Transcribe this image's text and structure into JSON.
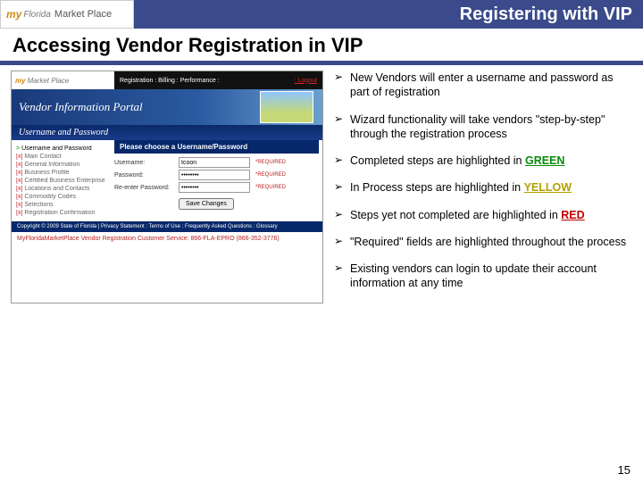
{
  "header": {
    "title": "Registering with VIP"
  },
  "subtitle": "Accessing Vendor Registration in VIP",
  "logo": {
    "my": "my",
    "florida": "Florida",
    "marketplace": "Market Place"
  },
  "screenshot": {
    "nav": {
      "items": "Registration : Billing : Performance :",
      "logout": ": Logout"
    },
    "banner": "Vendor Information Portal",
    "subbanner": "Username and Password",
    "sidebar": [
      {
        "marker": ">",
        "label": "Username and Password",
        "current": true
      },
      {
        "marker": "[x]",
        "label": "Main Contact"
      },
      {
        "marker": "[x]",
        "label": "General Information"
      },
      {
        "marker": "[x]",
        "label": "Business Profile"
      },
      {
        "marker": "[x]",
        "label": "Certified Business Enterprise"
      },
      {
        "marker": "[x]",
        "label": "Locations and Contacts"
      },
      {
        "marker": "[x]",
        "label": "Commodity Codes"
      },
      {
        "marker": "[x]",
        "label": "Selections"
      },
      {
        "marker": "[x]",
        "label": "Registration Confirmation"
      }
    ],
    "formHeader": "Please choose a Username/Password",
    "fields": {
      "username": {
        "label": "Username:",
        "value": "tcoon",
        "required": "*REQUIRED"
      },
      "password": {
        "label": "Password:",
        "value": "••••••••",
        "required": "*REQUIRED"
      },
      "password2": {
        "label": "Re-enter Password:",
        "value": "••••••••",
        "required": "*REQUIRED"
      }
    },
    "button": "Save Changes",
    "footer": "Copyright © 2009 State of Florida | Privacy Statement : Terms of Use : Frequently Asked Questions : Glossary",
    "support": "MyFloridaMarketPlace Vendor Registration Customer Service: 866-FLA-EPRO (866-352-3776)"
  },
  "bullets": [
    {
      "text": "New Vendors will enter a username and password as part of registration"
    },
    {
      "text": "Wizard functionality will take vendors \"step-by-step\" through the registration process"
    },
    {
      "text": "Completed steps are highlighted in ",
      "suffixClass": "green",
      "suffix": "GREEN"
    },
    {
      "text": "In Process steps are highlighted in ",
      "suffixClass": "yellow",
      "suffix": "YELLOW"
    },
    {
      "text": "Steps yet not completed are highlighted in ",
      "suffixClass": "red",
      "suffix": "RED"
    },
    {
      "text": "\"Required\" fields are highlighted throughout the process"
    },
    {
      "text": "Existing vendors can login to update their account information at any time"
    }
  ],
  "pageNumber": "15"
}
